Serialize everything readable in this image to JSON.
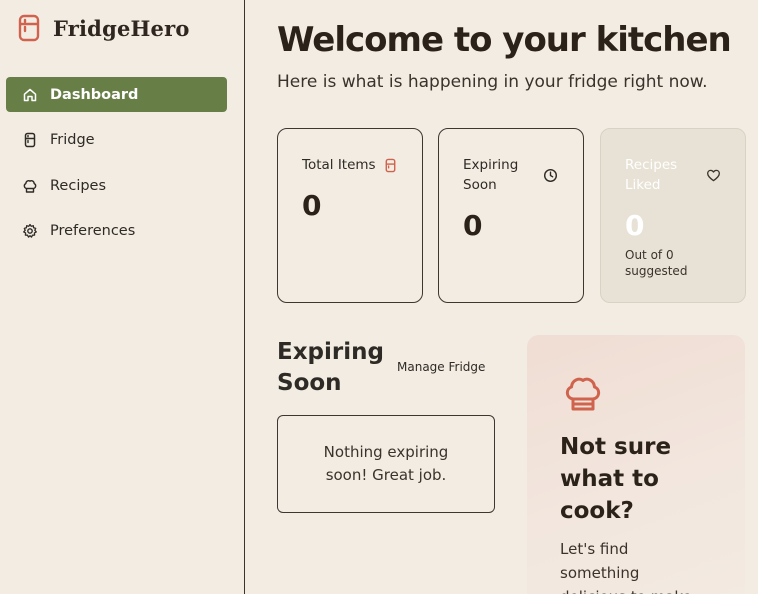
{
  "brand": {
    "name": "FridgeHero",
    "icon": "fridge-icon",
    "accent": "#d0634e"
  },
  "sidebar": {
    "items": [
      {
        "label": "Dashboard",
        "icon": "home-icon",
        "active": true
      },
      {
        "label": "Fridge",
        "icon": "fridge-icon",
        "active": false
      },
      {
        "label": "Recipes",
        "icon": "chef-hat-icon",
        "active": false
      },
      {
        "label": "Preferences",
        "icon": "gear-icon",
        "active": false
      }
    ],
    "active_color": "#677f47"
  },
  "header": {
    "title": "Welcome to your kitchen",
    "subtitle": "Here is what is happening in your fridge right now."
  },
  "stats": {
    "total_items": {
      "label": "Total Items",
      "value": "0",
      "icon": "fridge-icon"
    },
    "expiring_soon": {
      "label": "Expiring Soon",
      "value": "0",
      "icon": "clock-icon"
    },
    "recipes_liked": {
      "label": "Recipes Liked",
      "value": "0",
      "sub": "Out of 0 suggested",
      "icon": "heart-icon"
    }
  },
  "expiring": {
    "title": "Expiring Soon",
    "manage_label": "Manage Fridge",
    "empty_text": "Nothing expiring soon! Great job."
  },
  "promo": {
    "icon": "chef-hat-icon",
    "title": "Not sure what to cook?",
    "text": "Let's find something delicious to make"
  }
}
